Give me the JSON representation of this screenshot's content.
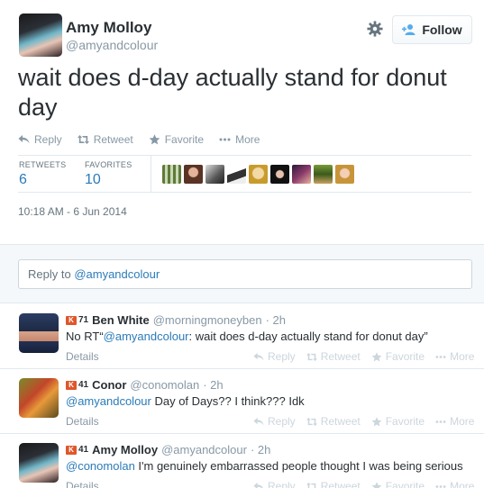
{
  "author": {
    "name": "Amy Molloy",
    "handle": "@amyandcolour"
  },
  "follow_button": {
    "label": "Follow"
  },
  "tweet": {
    "text": "wait does d-day actually stand for donut day"
  },
  "tweet_actions": {
    "reply": "Reply",
    "retweet": "Retweet",
    "favorite": "Favorite",
    "more": "More"
  },
  "stats": {
    "retweets_label": "RETWEETS",
    "retweets_value": "6",
    "favorites_label": "FAVORITES",
    "favorites_value": "10"
  },
  "timestamp": "10:18 AM - 6 Jun 2014",
  "reply_box": {
    "prefix": "Reply to ",
    "mention": "@amyandcolour"
  },
  "reply_actions": {
    "reply": "Reply",
    "retweet": "Retweet",
    "favorite": "Favorite",
    "more": "More",
    "details": "Details"
  },
  "replies": [
    {
      "klout": "71",
      "name": "Ben White",
      "handle": "@morningmoneyben",
      "time": "· 2h",
      "pre": "No RT“",
      "mention": "@amyandcolour",
      "post": ": wait does d-day actually stand for donut day”"
    },
    {
      "klout": "41",
      "name": "Conor",
      "handle": "@conomolan",
      "time": "· 2h",
      "pre": "",
      "mention": "@amyandcolour",
      "post": " Day of Days?? I think??? Idk"
    },
    {
      "klout": "41",
      "name": "Amy Molloy",
      "handle": "@amyandcolour",
      "time": "· 2h",
      "pre": "",
      "mention": "@conomolan",
      "post": " I'm genuinely embarrassed people thought I was being serious"
    }
  ],
  "colors": {
    "link": "#2b7bb9",
    "muted": "#8899a6",
    "klout": "#e0562a"
  }
}
